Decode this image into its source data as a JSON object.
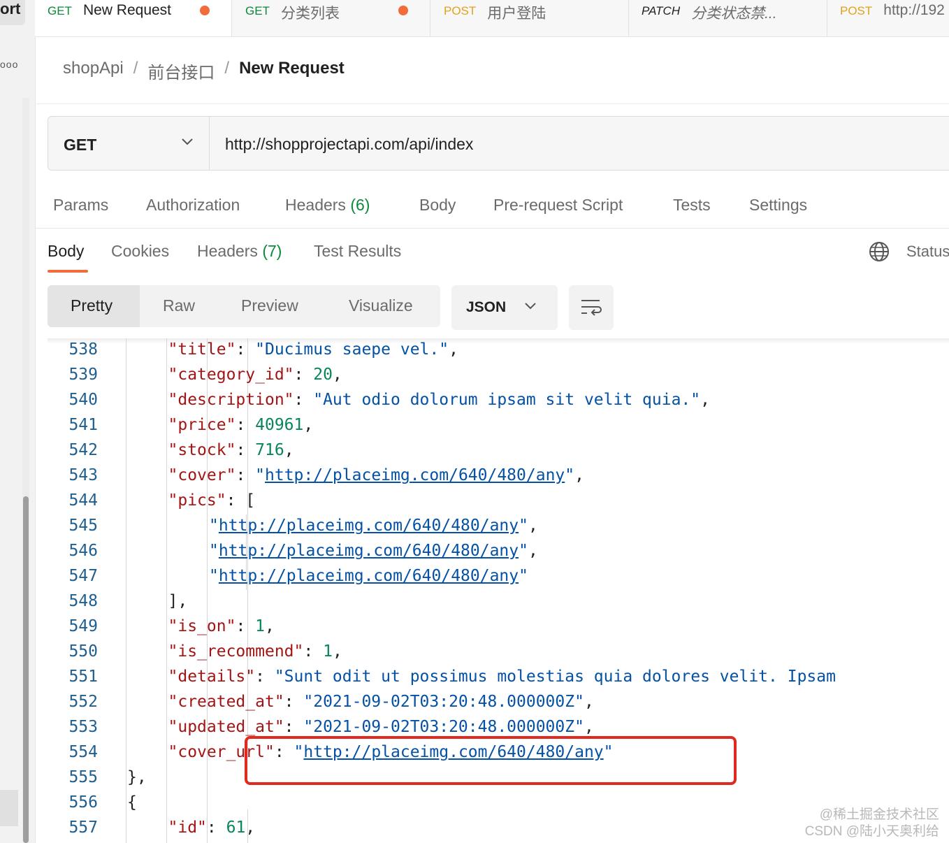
{
  "sidebar": {
    "title_fragment": "ort",
    "more_label": "ooo"
  },
  "tabs": [
    {
      "method": "GET",
      "name": "New Request",
      "unsaved": true,
      "active": true
    },
    {
      "method": "GET",
      "name": "分类列表",
      "unsaved": true,
      "active": false
    },
    {
      "method": "POST",
      "name": "用户登陆",
      "unsaved": false,
      "active": false
    },
    {
      "method": "PATCH",
      "name": "分类状态禁...",
      "unsaved": false,
      "active": false
    },
    {
      "method": "POST",
      "name": "http://192",
      "unsaved": false,
      "active": false
    }
  ],
  "breadcrumb": {
    "collection": "shopApi",
    "folder": "前台接口",
    "current": "New Request",
    "separator": "/"
  },
  "request": {
    "method": "GET",
    "url": "http://shopprojectapi.com/api/index"
  },
  "request_tabs": {
    "params": "Params",
    "authorization": "Authorization",
    "headers": "Headers",
    "headers_count": "(6)",
    "body": "Body",
    "prerequest": "Pre-request Script",
    "tests": "Tests",
    "settings": "Settings"
  },
  "response_tabs": {
    "body": "Body",
    "cookies": "Cookies",
    "headers": "Headers",
    "headers_count": "(7)",
    "test_results": "Test Results",
    "status": "Status"
  },
  "view_modes": {
    "pretty": "Pretty",
    "raw": "Raw",
    "preview": "Preview",
    "visualize": "Visualize",
    "active": "Pretty"
  },
  "format": "JSON",
  "colors": {
    "accent": "#f26b3a",
    "get": "#0b8a3a",
    "post": "#e6a11a",
    "highlight_box": "#e0291f"
  },
  "code": [
    {
      "ln": "538",
      "indent": 3,
      "tokens": [
        [
          "k",
          "\"title\""
        ],
        [
          "p",
          ": "
        ],
        [
          "s",
          "\"Ducimus saepe vel.\""
        ],
        [
          "p",
          ","
        ]
      ]
    },
    {
      "ln": "539",
      "indent": 3,
      "tokens": [
        [
          "k",
          "\"category_id\""
        ],
        [
          "p",
          ": "
        ],
        [
          "n",
          "20"
        ],
        [
          "p",
          ","
        ]
      ]
    },
    {
      "ln": "540",
      "indent": 3,
      "tokens": [
        [
          "k",
          "\"description\""
        ],
        [
          "p",
          ": "
        ],
        [
          "s",
          "\"Aut odio dolorum ipsam sit velit quia.\""
        ],
        [
          "p",
          ","
        ]
      ]
    },
    {
      "ln": "541",
      "indent": 3,
      "tokens": [
        [
          "k",
          "\"price\""
        ],
        [
          "p",
          ": "
        ],
        [
          "n",
          "40961"
        ],
        [
          "p",
          ","
        ]
      ]
    },
    {
      "ln": "542",
      "indent": 3,
      "tokens": [
        [
          "k",
          "\"stock\""
        ],
        [
          "p",
          ": "
        ],
        [
          "n",
          "716"
        ],
        [
          "p",
          ","
        ]
      ]
    },
    {
      "ln": "543",
      "indent": 3,
      "tokens": [
        [
          "k",
          "\"cover\""
        ],
        [
          "p",
          ": "
        ],
        [
          "s",
          "\""
        ],
        [
          "u",
          "http://placeimg.com/640/480/any"
        ],
        [
          "s",
          "\""
        ],
        [
          "p",
          ","
        ]
      ]
    },
    {
      "ln": "544",
      "indent": 3,
      "tokens": [
        [
          "k",
          "\"pics\""
        ],
        [
          "p",
          ": ["
        ]
      ]
    },
    {
      "ln": "545",
      "indent": 4,
      "tokens": [
        [
          "s",
          "\""
        ],
        [
          "u",
          "http://placeimg.com/640/480/any"
        ],
        [
          "s",
          "\""
        ],
        [
          "p",
          ","
        ]
      ]
    },
    {
      "ln": "546",
      "indent": 4,
      "tokens": [
        [
          "s",
          "\""
        ],
        [
          "u",
          "http://placeimg.com/640/480/any"
        ],
        [
          "s",
          "\""
        ],
        [
          "p",
          ","
        ]
      ]
    },
    {
      "ln": "547",
      "indent": 4,
      "tokens": [
        [
          "s",
          "\""
        ],
        [
          "u",
          "http://placeimg.com/640/480/any"
        ],
        [
          "s",
          "\""
        ]
      ]
    },
    {
      "ln": "548",
      "indent": 3,
      "tokens": [
        [
          "p",
          "],"
        ]
      ]
    },
    {
      "ln": "549",
      "indent": 3,
      "tokens": [
        [
          "k",
          "\"is_on\""
        ],
        [
          "p",
          ": "
        ],
        [
          "n",
          "1"
        ],
        [
          "p",
          ","
        ]
      ]
    },
    {
      "ln": "550",
      "indent": 3,
      "tokens": [
        [
          "k",
          "\"is_recommend\""
        ],
        [
          "p",
          ": "
        ],
        [
          "n",
          "1"
        ],
        [
          "p",
          ","
        ]
      ]
    },
    {
      "ln": "551",
      "indent": 3,
      "tokens": [
        [
          "k",
          "\"details\""
        ],
        [
          "p",
          ": "
        ],
        [
          "s",
          "\"Sunt odit ut possimus molestias quia dolores velit. Ipsam"
        ]
      ]
    },
    {
      "ln": "552",
      "indent": 3,
      "tokens": [
        [
          "k",
          "\"created_at\""
        ],
        [
          "p",
          ": "
        ],
        [
          "s",
          "\"2021-09-02T03:20:48.000000Z\""
        ],
        [
          "p",
          ","
        ]
      ]
    },
    {
      "ln": "553",
      "indent": 3,
      "tokens": [
        [
          "k",
          "\"updated_at\""
        ],
        [
          "p",
          ": "
        ],
        [
          "s",
          "\"2021-09-02T03:20:48.000000Z\""
        ],
        [
          "p",
          ","
        ]
      ]
    },
    {
      "ln": "554",
      "indent": 3,
      "tokens": [
        [
          "k",
          "\"cover_url\""
        ],
        [
          "p",
          ": "
        ],
        [
          "s",
          "\""
        ],
        [
          "u",
          "http://placeimg.com/640/480/any"
        ],
        [
          "s",
          "\""
        ]
      ]
    },
    {
      "ln": "555",
      "indent": 2,
      "tokens": [
        [
          "p",
          "},"
        ]
      ]
    },
    {
      "ln": "556",
      "indent": 2,
      "tokens": [
        [
          "p",
          "{"
        ]
      ]
    },
    {
      "ln": "557",
      "indent": 3,
      "tokens": [
        [
          "k",
          "\"id\""
        ],
        [
          "p",
          ": "
        ],
        [
          "n",
          "61"
        ],
        [
          "p",
          ","
        ]
      ]
    }
  ],
  "watermark": {
    "line1": "@稀土掘金技术社区",
    "line2": "CSDN @陆小天奥利给"
  }
}
